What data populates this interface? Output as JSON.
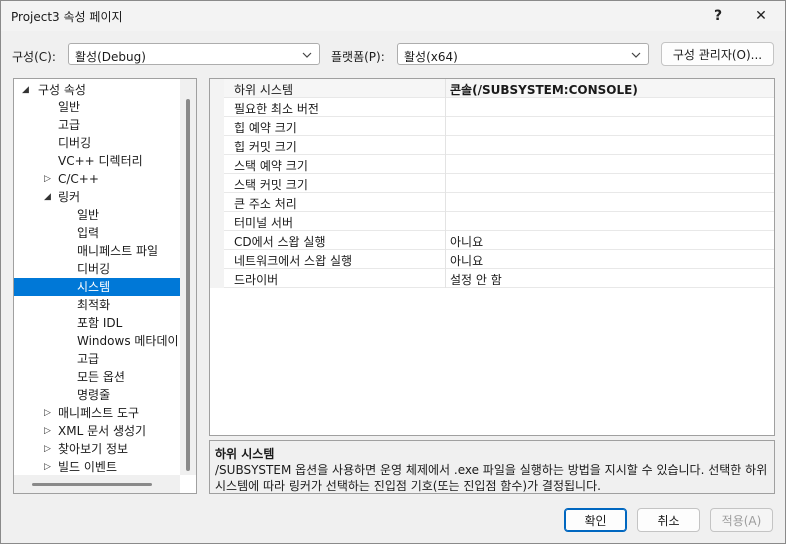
{
  "window": {
    "title": "Project3 속성 페이지",
    "help": "?",
    "close": "✕"
  },
  "config": {
    "config_label": "구성(C):",
    "config_value": "활성(Debug)",
    "platform_label": "플랫폼(P):",
    "platform_value": "활성(x64)",
    "manager_button": "구성 관리자(O)..."
  },
  "tree": {
    "items": [
      {
        "label": "구성 속성",
        "expanded": true
      },
      {
        "label": "일반"
      },
      {
        "label": "고급"
      },
      {
        "label": "디버깅"
      },
      {
        "label": "VC++ 디렉터리"
      },
      {
        "label": "C/C++",
        "expanded": false
      },
      {
        "label": "링커",
        "expanded": true
      },
      {
        "label": "일반"
      },
      {
        "label": "입력"
      },
      {
        "label": "매니페스트 파일"
      },
      {
        "label": "디버깅"
      },
      {
        "label": "시스템",
        "selected": true
      },
      {
        "label": "최적화"
      },
      {
        "label": "포함 IDL"
      },
      {
        "label": "Windows 메타데이"
      },
      {
        "label": "고급"
      },
      {
        "label": "모든 옵션"
      },
      {
        "label": "명령줄"
      },
      {
        "label": "매니페스트 도구",
        "expanded": false
      },
      {
        "label": "XML 문서 생성기",
        "expanded": false
      },
      {
        "label": "찾아보기 정보",
        "expanded": false
      },
      {
        "label": "빌드 이벤트",
        "expanded": false
      }
    ]
  },
  "properties": [
    {
      "name": "하위 시스템",
      "value": "콘솔(/SUBSYSTEM:CONSOLE)",
      "bold": true
    },
    {
      "name": "필요한 최소 버전",
      "value": ""
    },
    {
      "name": "힙 예약 크기",
      "value": ""
    },
    {
      "name": "힙 커밋 크기",
      "value": ""
    },
    {
      "name": "스택 예약 크기",
      "value": ""
    },
    {
      "name": "스택 커밋 크기",
      "value": ""
    },
    {
      "name": "큰 주소 처리",
      "value": ""
    },
    {
      "name": "터미널 서버",
      "value": ""
    },
    {
      "name": "CD에서 스왑 실행",
      "value": "아니요"
    },
    {
      "name": "네트워크에서 스왑 실행",
      "value": "아니요"
    },
    {
      "name": "드라이버",
      "value": "설정 안 함"
    }
  ],
  "description": {
    "title": "하위 시스템",
    "text": "/SUBSYSTEM 옵션을 사용하면 운영 체제에서 .exe 파일을 실행하는 방법을 지시할 수 있습니다. 선택한 하위 시스템에 따라 링커가 선택하는 진입점 기호(또는 진입점 함수)가 결정됩니다."
  },
  "buttons": {
    "ok": "확인",
    "cancel": "취소",
    "apply": "적용(A)"
  },
  "colors": {
    "selection": "#0078d7",
    "primary_border": "#0067c0"
  }
}
